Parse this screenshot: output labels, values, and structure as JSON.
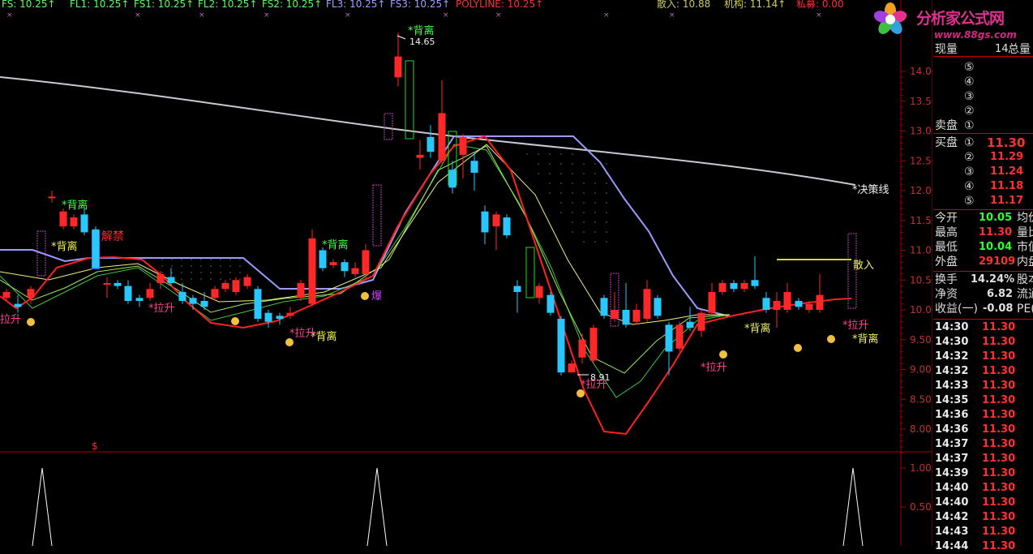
{
  "header": {
    "items": [
      {
        "label": "FS: 10.25↑",
        "color": "#5aff5a"
      },
      {
        "label": "FL1: 10.25↑",
        "color": "#5aff5a"
      },
      {
        "label": "FS1: 10.25↑",
        "color": "#5aff5a"
      },
      {
        "label": "FL2: 10.25↑",
        "color": "#5aff5a"
      },
      {
        "label": "FS2: 10.25↑",
        "color": "#5aff5a"
      },
      {
        "label": "FL3: 10.25↑",
        "color": "#9fa0ff"
      },
      {
        "label": "FS3: 10.25↑",
        "color": "#9fa0ff"
      },
      {
        "label": "POLYLINE: 10.25↑",
        "color": "#ff3030"
      }
    ],
    "right_items": [
      {
        "label": "散入: 10.88",
        "color": "#c8c860"
      },
      {
        "label": "机构: 11.14↑",
        "color": "#d0d050"
      },
      {
        "label": "私募: 0.00",
        "color": "#ff3030"
      }
    ]
  },
  "logo": {
    "text": "分析家公式网",
    "url": "www.88gs.com"
  },
  "price_axis": {
    "labels": [
      "14.00",
      "13.50",
      "13.00",
      "12.50",
      "12.00",
      "11.50",
      "11.00",
      "10.50",
      "10.00",
      "9.50",
      "9.00",
      "8.50",
      "8.00"
    ],
    "ylim": [
      7.75,
      14.6
    ]
  },
  "indicator_axis": {
    "labels": [
      "1.00",
      "0.50"
    ]
  },
  "annotations": {
    "beili_labels": [
      "*背离",
      "*背离",
      "*背离",
      "*背离",
      "*背离",
      "*背离",
      "*背离"
    ],
    "lasheng_labels": [
      "*拉升",
      "*拉升",
      "*拉升",
      "*拉升",
      "拉升"
    ],
    "jiejin": "解禁",
    "bao": "爆",
    "juece": "*决策线",
    "sanru": "散入",
    "high_price": "14.65",
    "low_price": "8.91",
    "dollar": "$"
  },
  "quote_panel": {
    "xianliang_label": "现量",
    "xianliang_value": "14",
    "zongliang_label": "总量",
    "sell_levels": [
      "⑤",
      "④",
      "③",
      "②",
      "①"
    ],
    "sell_label": "卖盘",
    "buy_label": "买盘",
    "buy": [
      {
        "level": "①",
        "price": "11.30"
      },
      {
        "level": "②",
        "price": "11.29"
      },
      {
        "level": "③",
        "price": "11.24"
      },
      {
        "level": "④",
        "price": "11.18"
      },
      {
        "level": "⑤",
        "price": "11.17"
      }
    ],
    "stats": [
      {
        "label": "今开",
        "value": "10.05",
        "value_color": "#30ff30",
        "right": "均价"
      },
      {
        "label": "最高",
        "value": "11.30",
        "value_color": "#ff3030",
        "right": "量比"
      },
      {
        "label": "最低",
        "value": "10.04",
        "value_color": "#30ff30",
        "right": "市值"
      },
      {
        "label": "外盘",
        "value": "29109",
        "value_color": "#ff3030",
        "right": "内盘"
      }
    ],
    "stats2": [
      {
        "label": "换手",
        "value": "14.24%",
        "value_color": "#e0e0e0",
        "right": "股本"
      },
      {
        "label": "净资",
        "value": "6.82",
        "value_color": "#e0e0e0",
        "right": "流通"
      },
      {
        "label": "收益(一)",
        "value": "-0.08",
        "value_color": "#e0e0e0",
        "right": "PE(动"
      }
    ],
    "ticks": [
      {
        "time": "14:30",
        "price": "11.30"
      },
      {
        "time": "14:30",
        "price": "11.30"
      },
      {
        "time": "14:32",
        "price": "11.30"
      },
      {
        "time": "14:32",
        "price": "11.30"
      },
      {
        "time": "14:33",
        "price": "11.30"
      },
      {
        "time": "14:35",
        "price": "11.30"
      },
      {
        "time": "14:36",
        "price": "11.30"
      },
      {
        "time": "14:36",
        "price": "11.30"
      },
      {
        "time": "14:37",
        "price": "11.30"
      },
      {
        "time": "14:37",
        "price": "11.30"
      },
      {
        "time": "14:39",
        "price": "11.30"
      },
      {
        "time": "14:40",
        "price": "11.30"
      },
      {
        "time": "14:40",
        "price": "11.30"
      },
      {
        "time": "14:42",
        "price": "11.30"
      },
      {
        "time": "14:43",
        "price": "11.30"
      },
      {
        "time": "14:44",
        "price": "11.30"
      }
    ]
  },
  "chart_data": {
    "type": "candlestick",
    "ylim": [
      7.75,
      14.6
    ],
    "candles": [
      {
        "o": 10.2,
        "c": 10.3,
        "h": 10.35,
        "l": 10.15
      },
      {
        "o": 10.1,
        "c": 10.05,
        "h": 10.25,
        "l": 9.95
      },
      {
        "o": 10.2,
        "c": 10.35,
        "h": 10.4,
        "l": 10.1
      },
      {
        "o": 11.9,
        "c": 11.9,
        "h": 12.0,
        "l": 11.8
      },
      {
        "o": 11.4,
        "c": 11.65,
        "h": 11.7,
        "l": 11.35
      },
      {
        "o": 11.4,
        "c": 11.55,
        "h": 11.6,
        "l": 11.35
      },
      {
        "o": 11.6,
        "c": 11.3,
        "h": 11.7,
        "l": 11.25
      },
      {
        "o": 11.35,
        "c": 10.7,
        "h": 11.4,
        "l": 10.7
      },
      {
        "o": 10.45,
        "c": 10.45,
        "h": 10.55,
        "l": 10.2
      },
      {
        "o": 10.45,
        "c": 10.4,
        "h": 10.5,
        "l": 10.35
      },
      {
        "o": 10.4,
        "c": 10.15,
        "h": 10.5,
        "l": 10.1
      },
      {
        "o": 10.2,
        "c": 10.15,
        "h": 10.25,
        "l": 10.05
      },
      {
        "o": 10.2,
        "c": 10.35,
        "h": 10.45,
        "l": 10.15
      },
      {
        "o": 10.45,
        "c": 10.6,
        "h": 10.65,
        "l": 10.35
      },
      {
        "o": 10.55,
        "c": 10.45,
        "h": 10.7,
        "l": 10.4
      },
      {
        "o": 10.3,
        "c": 10.15,
        "h": 10.45,
        "l": 10.1
      },
      {
        "o": 10.2,
        "c": 10.1,
        "h": 10.25,
        "l": 10.0
      },
      {
        "o": 10.15,
        "c": 10.05,
        "h": 10.3,
        "l": 10.0
      },
      {
        "o": 10.2,
        "c": 10.35,
        "h": 10.4,
        "l": 10.15
      },
      {
        "o": 10.35,
        "c": 10.45,
        "h": 10.5,
        "l": 10.3
      },
      {
        "o": 10.3,
        "c": 10.5,
        "h": 10.55,
        "l": 10.25
      },
      {
        "o": 10.4,
        "c": 10.55,
        "h": 10.6,
        "l": 10.35
      },
      {
        "o": 10.35,
        "c": 9.85,
        "h": 10.4,
        "l": 9.8
      },
      {
        "o": 9.95,
        "c": 9.8,
        "h": 10.0,
        "l": 9.7
      },
      {
        "o": 9.9,
        "c": 9.85,
        "h": 9.95,
        "l": 9.75
      },
      {
        "o": 9.9,
        "c": 9.95,
        "h": 10.05,
        "l": 9.85
      },
      {
        "o": 10.2,
        "c": 10.45,
        "h": 10.5,
        "l": 10.15
      },
      {
        "o": 10.1,
        "c": 11.2,
        "h": 11.35,
        "l": 10.05
      },
      {
        "o": 11.0,
        "c": 10.7,
        "h": 11.05,
        "l": 10.65
      },
      {
        "o": 10.75,
        "c": 10.8,
        "h": 10.85,
        "l": 10.7
      },
      {
        "o": 10.8,
        "c": 10.65,
        "h": 10.85,
        "l": 10.55
      },
      {
        "o": 10.6,
        "c": 10.7,
        "h": 10.8,
        "l": 10.55
      },
      {
        "o": 10.6,
        "c": 11.0,
        "h": 11.1,
        "l": 10.5
      },
      {
        "o": 13.9,
        "c": 14.25,
        "h": 14.65,
        "l": 13.75
      },
      {
        "o": 12.55,
        "c": 12.6,
        "h": 12.85,
        "l": 12.35
      },
      {
        "o": 12.9,
        "c": 12.65,
        "h": 13.1,
        "l": 12.55
      },
      {
        "o": 12.5,
        "c": 13.3,
        "h": 13.85,
        "l": 12.45
      },
      {
        "o": 12.35,
        "c": 12.05,
        "h": 12.5,
        "l": 11.95
      },
      {
        "o": 12.6,
        "c": 12.9,
        "h": 12.95,
        "l": 12.2
      },
      {
        "o": 12.5,
        "c": 12.3,
        "h": 12.65,
        "l": 12.0
      },
      {
        "o": 11.65,
        "c": 11.3,
        "h": 11.75,
        "l": 11.1
      },
      {
        "o": 11.4,
        "c": 11.6,
        "h": 11.65,
        "l": 11.0
      },
      {
        "o": 11.55,
        "c": 11.25,
        "h": 11.6,
        "l": 11.2
      },
      {
        "o": 10.4,
        "c": 10.3,
        "h": 10.5,
        "l": 9.95
      },
      {
        "o": 10.2,
        "c": 10.4,
        "h": 10.45,
        "l": 10.1
      },
      {
        "o": 10.25,
        "c": 9.95,
        "h": 10.3,
        "l": 9.9
      },
      {
        "o": 9.85,
        "c": 8.95,
        "h": 9.9,
        "l": 8.9
      },
      {
        "o": 8.95,
        "c": 9.1,
        "h": 9.15,
        "l": 8.95
      },
      {
        "o": 9.2,
        "c": 9.5,
        "h": 9.6,
        "l": 9.1
      },
      {
        "o": 9.15,
        "c": 9.7,
        "h": 9.75,
        "l": 9.1
      },
      {
        "o": 10.2,
        "c": 9.9,
        "h": 10.25,
        "l": 9.85
      },
      {
        "o": 9.85,
        "c": 10.0,
        "h": 10.3,
        "l": 9.8
      },
      {
        "o": 10.0,
        "c": 9.75,
        "h": 10.45,
        "l": 9.7
      },
      {
        "o": 9.8,
        "c": 10.0,
        "h": 10.1,
        "l": 9.75
      },
      {
        "o": 9.85,
        "c": 10.35,
        "h": 10.5,
        "l": 9.8
      },
      {
        "o": 10.2,
        "c": 9.9,
        "h": 10.25,
        "l": 9.85
      },
      {
        "o": 9.75,
        "c": 9.3,
        "h": 9.8,
        "l": 8.9
      },
      {
        "o": 9.35,
        "c": 9.75,
        "h": 9.8,
        "l": 9.3
      },
      {
        "o": 9.8,
        "c": 9.7,
        "h": 10.05,
        "l": 9.65
      },
      {
        "o": 9.65,
        "c": 9.95,
        "h": 10.0,
        "l": 9.55
      },
      {
        "o": 9.95,
        "c": 10.3,
        "h": 10.45,
        "l": 9.9
      },
      {
        "o": 10.3,
        "c": 10.45,
        "h": 10.5,
        "l": 10.25
      },
      {
        "o": 10.45,
        "c": 10.35,
        "h": 10.5,
        "l": 10.3
      },
      {
        "o": 10.35,
        "c": 10.45,
        "h": 10.5,
        "l": 10.3
      },
      {
        "o": 10.5,
        "c": 10.4,
        "h": 10.9,
        "l": 10.35
      },
      {
        "o": 10.2,
        "c": 10.0,
        "h": 10.3,
        "l": 9.95
      },
      {
        "o": 10.0,
        "c": 10.15,
        "h": 10.3,
        "l": 9.7
      },
      {
        "o": 10.0,
        "c": 10.3,
        "h": 10.45,
        "l": 9.95
      },
      {
        "o": 10.15,
        "c": 10.05,
        "h": 10.2,
        "l": 10.0
      },
      {
        "o": 10.0,
        "c": 10.1,
        "h": 10.15,
        "l": 9.95
      },
      {
        "o": 10.0,
        "c": 10.25,
        "h": 10.6,
        "l": 9.95
      }
    ],
    "lines": {
      "decision": {
        "color": "#c8c8d8",
        "y": [
          12.85,
          12.65,
          12.45,
          12.25,
          12.1
        ]
      },
      "red_curve": {
        "color": "#ff2020"
      },
      "blue_band": {
        "color": "#9a9aff"
      }
    },
    "indicator": {
      "ylim": [
        0,
        1.1
      ],
      "peaks": [
        1,
        1,
        1
      ]
    }
  }
}
